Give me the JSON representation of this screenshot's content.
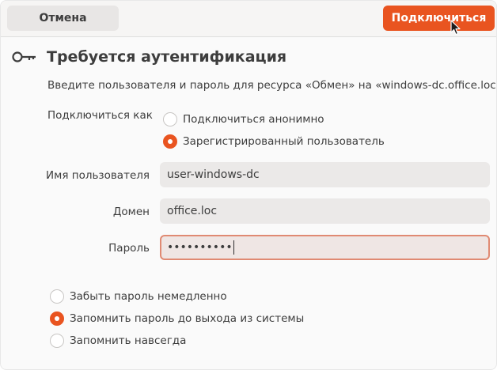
{
  "header": {
    "cancel_label": "Отмена",
    "connect_label": "Подключиться"
  },
  "title": "Требуется аутентификация",
  "prompt": "Введите пользователя и пароль для ресурса «Обмен» на «windows-dc.office.loc»:",
  "connect_as": {
    "label": "Подключиться как",
    "options": [
      {
        "label": "Подключиться анонимно",
        "checked": false
      },
      {
        "label": "Зарегистрированный пользователь",
        "checked": true
      }
    ]
  },
  "fields": {
    "username": {
      "label": "Имя пользователя",
      "value": "user-windows-dc"
    },
    "domain": {
      "label": "Домен",
      "value": "office.loc"
    },
    "password": {
      "label": "Пароль",
      "value": "••••••••••"
    }
  },
  "remember": {
    "options": [
      {
        "label": "Забыть пароль немедленно",
        "checked": false
      },
      {
        "label": "Запомнить пароль до выхода из системы",
        "checked": true
      },
      {
        "label": "Запомнить навсегда",
        "checked": false
      }
    ]
  },
  "colors": {
    "accent": "#e95420",
    "focus_border": "#e08a73"
  },
  "icons": {
    "title_icon": "key-icon",
    "cursor": "mouse-pointer-icon"
  }
}
